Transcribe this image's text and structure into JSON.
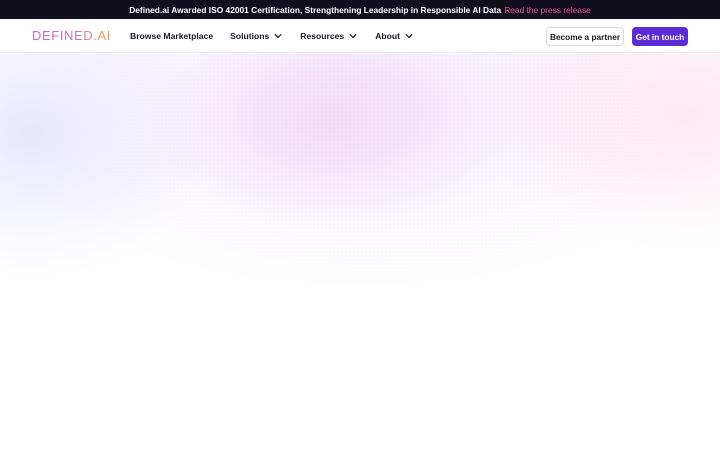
{
  "announcement": {
    "text": "Defined.ai Awarded ISO 42001 Certification, Strengthening Leadership in Responsible AI Data",
    "link_label": "Read the press release",
    "link_color": "#e9559f",
    "background": "#120f1c"
  },
  "header": {
    "logo": {
      "part1": "D",
      "part2": "EFI",
      "part3": "NE",
      "part4": "D",
      "part5": ".",
      "part6": "AI"
    },
    "nav": [
      {
        "label": "Browse Marketplace",
        "has_dropdown": false
      },
      {
        "label": "Solutions",
        "has_dropdown": true,
        "icon": "chevron-down-icon"
      },
      {
        "label": "Resources",
        "has_dropdown": true,
        "icon": "chevron-down-icon"
      },
      {
        "label": "About",
        "has_dropdown": true,
        "icon": "chevron-down-icon"
      }
    ],
    "partner_button": "Become a partner",
    "cta_button": "Get in touch",
    "cta_color": "#5b2bd8"
  }
}
